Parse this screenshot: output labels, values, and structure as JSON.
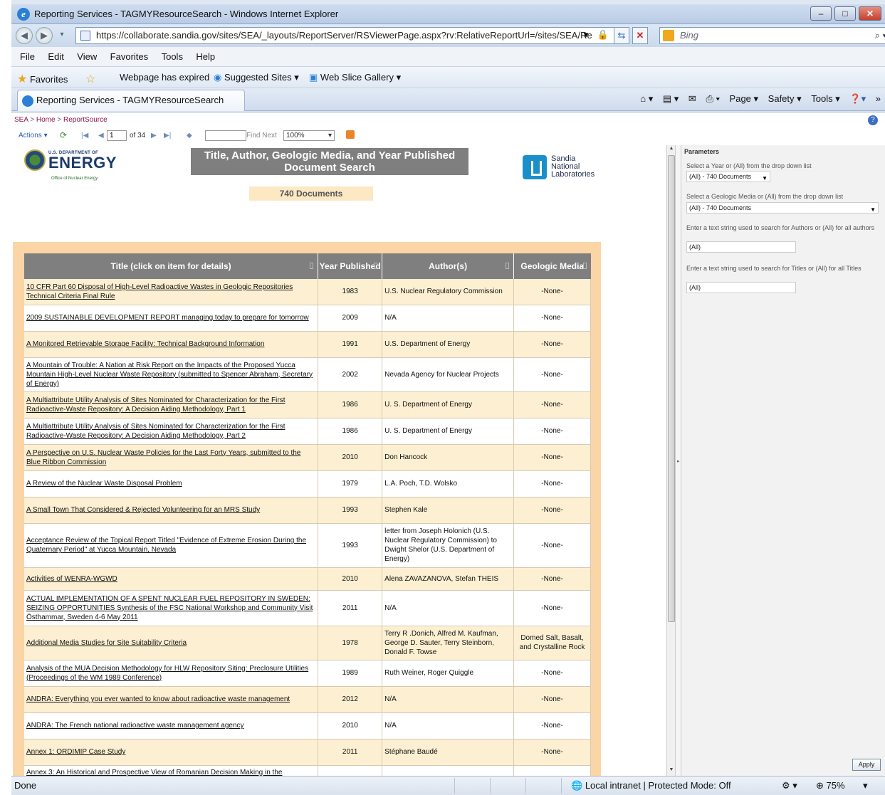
{
  "window": {
    "title": "Reporting Services - TAGMYResourceSearch - Windows Internet Explorer",
    "min": "–",
    "max": "□",
    "close": "✕"
  },
  "address": {
    "url": "https://collaborate.sandia.gov/sites/SEA/_layouts/ReportServer/RSViewerPage.aspx?rv:RelativeReportUrl=/sites/SEA/Re",
    "search_placeholder": "Bing"
  },
  "menu": [
    "File",
    "Edit",
    "View",
    "Favorites",
    "Tools",
    "Help"
  ],
  "favorites": {
    "favorites_label": "Favorites",
    "expired": "Webpage has expired",
    "suggested": "Suggested Sites ▾",
    "webslice": "Web Slice Gallery ▾"
  },
  "tab": {
    "label": "Reporting Services - TAGMYResourceSearch",
    "cmds": [
      "Page ▾",
      "Safety ▾",
      "Tools ▾"
    ]
  },
  "breadcrumb": {
    "a": "SEA",
    "b": "Home",
    "c": "ReportSource",
    "sep": ">"
  },
  "rstoolbar": {
    "actions": "Actions ▾",
    "page": "1",
    "of": "of 34",
    "find_next": "Find Next",
    "zoom": "100%"
  },
  "report": {
    "doe_small": "U.S. DEPARTMENT OF",
    "doe_big": "ENERGY",
    "doe_sub": "Office of Nuclear Energy",
    "title_line1": "Title, Author, Geologic Media, and Year Published",
    "title_line2": "Document Search",
    "count": "740 Documents",
    "sandia_1": "Sandia",
    "sandia_2": "National",
    "sandia_3": "Laboratories"
  },
  "table": {
    "headers": [
      "Title (click on item for details)",
      "Year Published",
      "Author(s)",
      "Geologic Media"
    ],
    "rows": [
      [
        "10 CFR Part 60 Disposal of High-Level Radioactive Wastes in Geologic Repositories Technical Criteria Final Rule",
        "1983",
        "U.S. Nuclear Regulatory Commission",
        "-None-"
      ],
      [
        "2009 SUSTAINABLE DEVELOPMENT REPORT managing today to prepare for tomorrow",
        "2009",
        "N/A",
        "-None-"
      ],
      [
        "A Monitored Retrievable Storage Facility: Technical Background Information",
        "1991",
        "U.S. Department of Energy",
        "-None-"
      ],
      [
        "A Mountain of Trouble: A Nation at Risk Report on the Impacts of the Proposed Yucca Mountain High-Level Nuclear Waste Repository (submitted to Spencer Abraham, Secretary of Energy)",
        "2002",
        "Nevada Agency for Nuclear Projects",
        "-None-"
      ],
      [
        "A Multiattribute Utility Analysis of Sites Nominated for Characterization for the First Radioactive-Waste Repository: A Decision Aiding Methodology, Part 1",
        "1986",
        "U. S. Department of Energy",
        "-None-"
      ],
      [
        "A Multiattribute Utility Analysis of Sites Nominated for Characterization for the First Radioactive-Waste Repository: A Decision Aiding Methodology, Part 2",
        "1986",
        "U. S. Department of Energy",
        "-None-"
      ],
      [
        "A Perspective on U.S. Nuclear Waste Policies for the Last Forty Years, submitted to the Blue Ribbon Commission",
        "2010",
        "Don Hancock",
        "-None-"
      ],
      [
        "A Review of the Nuclear Waste Disposal Problem",
        "1979",
        "L.A. Poch, T.D. Wolsko",
        "-None-"
      ],
      [
        "A Small Town That Considered & Rejected Volunteering for an MRS Study",
        "1993",
        "Stephen Kale",
        "-None-"
      ],
      [
        "Acceptance Review of the Topical Report Titled \"Evidence of Extreme Erosion During the Quaternary Period\" at Yucca Mountain, Nevada",
        "1993",
        "letter from Joseph Holonich (U.S. Nuclear Regulatory Commission) to Dwight Shelor (U.S. Department of Energy)",
        "-None-"
      ],
      [
        "Activities of WENRA-WGWD",
        "2010",
        "Alena ZAVAZANOVA, Stefan THEIS",
        "-None-"
      ],
      [
        "ACTUAL IMPLEMENTATION OF A SPENT NUCLEAR FUEL REPOSITORY IN SWEDEN: SEIZING OPPORTUNITIES Synthesis of the FSC National Workshop and Community Visit Östhammar, Sweden 4-6 May 2011",
        "2011",
        "N/A",
        "-None-"
      ],
      [
        "Additional Media Studies for Site Suitability Criteria",
        "1978",
        "Terry R .Donich, Alfred M. Kaufman, George D. Sauter, Terry Steinborn, Donald F. Towse",
        "Domed Salt, Basalt, and Crystalline Rock"
      ],
      [
        "Analysis of the MUA Decision Methodology for HLW Repository Siting: Preclosure Utilities (Proceedings of the WM 1989 Conference)",
        "1989",
        "Ruth Weiner, Roger Quiggle",
        "-None-"
      ],
      [
        "ANDRA: Everything you ever wanted to know about radioactive waste management",
        "2012",
        "N/A",
        "-None-"
      ],
      [
        "ANDRA: The French national radioactive waste management agency",
        "2010",
        "N/A",
        "-None-"
      ],
      [
        "Annex 1: ORDIMIP Case Study",
        "2011",
        "Stéphane Baudé",
        "-None-"
      ],
      [
        "Annex 3: An Historical and Prospective View of Romanian Decision Making in the",
        "",
        "",
        ""
      ]
    ]
  },
  "parameters": {
    "header": "Parameters",
    "year_label": "Select a Year or (All) from the drop down list",
    "year_value": "(All) - 740 Documents",
    "media_label": "Select a Geologic Media or (All) from the drop down list",
    "media_value": "(All) - 740 Documents",
    "author_label": "Enter a text string used to search for Authors or (All) for all authors",
    "author_value": "(All)",
    "title_label": "Enter a text string used to search for Titles or (All) for all Titles",
    "title_value": "(All)",
    "apply": "Apply"
  },
  "status": {
    "done": "Done",
    "zone": "Local intranet | Protected Mode: Off",
    "zoom": "75%"
  }
}
